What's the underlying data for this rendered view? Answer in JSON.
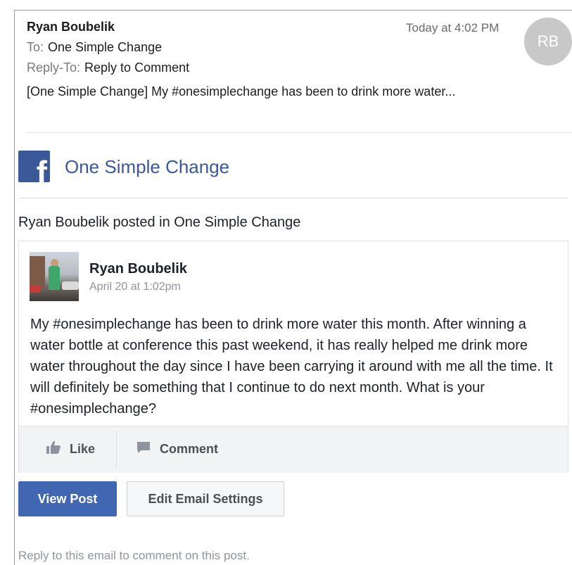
{
  "email_header": {
    "sender": "Ryan Boubelik",
    "time": "Today at 4:02 PM",
    "avatar_initials": "RB",
    "to_label": "To:",
    "to_value": "One Simple Change",
    "reply_to_label": "Reply-To:",
    "reply_to_value": "Reply to Comment",
    "subject": "[One Simple Change] My #onesimplechange has been to drink more water..."
  },
  "group": {
    "logo_glyph": "f",
    "name": "One Simple Change"
  },
  "notification": {
    "posted_in": "Ryan Boubelik posted in One Simple Change"
  },
  "post": {
    "author": "Ryan Boubelik",
    "date": "April 20 at 1:02pm",
    "body": "My #onesimplechange has been to drink more water this month. After winning a water bottle at conference this past weekend, it has really helped me drink more water throughout the day since I have been carrying it around with me all the time. It will definitely be something that I continue to do next month. What is your #onesimplechange?",
    "actions": {
      "like_label": "Like",
      "comment_label": "Comment"
    }
  },
  "buttons": {
    "view_post": "View Post",
    "edit_settings": "Edit Email Settings"
  },
  "footer": {
    "text": "Reply to this email to comment on this post."
  },
  "colors": {
    "facebook_blue": "#3b5998",
    "button_blue": "#4267b2",
    "meta_gray": "#90949c"
  }
}
